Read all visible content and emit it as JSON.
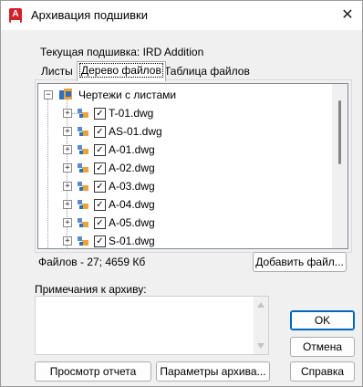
{
  "window": {
    "title": "Архивация подшивки",
    "close_glyph": "✕",
    "app_icon_letter": "A"
  },
  "subset": {
    "label": "Текущая подшивка: IRD Addition"
  },
  "tabs": [
    {
      "label": "Листы",
      "active": false
    },
    {
      "label": "Дерево файлов",
      "active": true
    },
    {
      "label": "Таблица файлов",
      "active": false
    }
  ],
  "tree": {
    "root_label": "Чертежи с листами",
    "items": [
      {
        "label": "T-01.dwg",
        "checked": true
      },
      {
        "label": "AS-01.dwg",
        "checked": true
      },
      {
        "label": "A-01.dwg",
        "checked": true
      },
      {
        "label": "A-02.dwg",
        "checked": true
      },
      {
        "label": "A-03.dwg",
        "checked": true
      },
      {
        "label": "A-04.dwg",
        "checked": true
      },
      {
        "label": "A-05.dwg",
        "checked": true
      },
      {
        "label": "S-01.dwg",
        "checked": true
      }
    ]
  },
  "summary": {
    "files_text": "Файлов - 27; 4659 Кб"
  },
  "buttons": {
    "add_file": "Добавить файл...",
    "ok": "OK",
    "cancel": "Отмена",
    "help": "Справка",
    "view_report": "Просмотр отчета",
    "archive_options": "Параметры архива..."
  },
  "notes": {
    "label": "Примечания к архиву:",
    "value": ""
  },
  "colors": {
    "accent": "#0067c0",
    "app_icon": "#d0202a"
  }
}
